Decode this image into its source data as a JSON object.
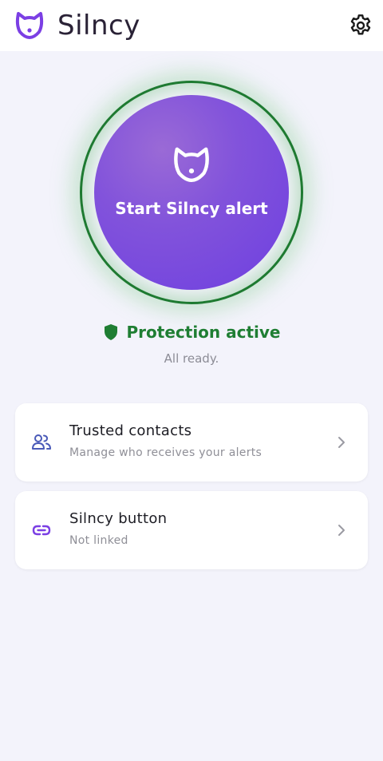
{
  "header": {
    "app_name": "Silncy",
    "logo_icon": "silncy-cat-logo-icon",
    "settings_icon": "gear-icon"
  },
  "alert": {
    "button_label": "Start Silncy alert",
    "icon": "silncy-cat-logo-icon"
  },
  "status": {
    "icon": "shield-icon",
    "title": "Protection active",
    "subtitle": "All ready."
  },
  "cards": [
    {
      "title": "Trusted contacts",
      "subtitle": "Manage who receives your alerts",
      "icon": "people-icon"
    },
    {
      "title": "Silncy button",
      "subtitle": "Not linked",
      "icon": "link-icon"
    }
  ],
  "colors": {
    "brand_purple": "#7b3fe4",
    "status_green": "#1f7e33",
    "background": "#f3f3fb",
    "card_icon_blue": "#4a5ab8"
  }
}
